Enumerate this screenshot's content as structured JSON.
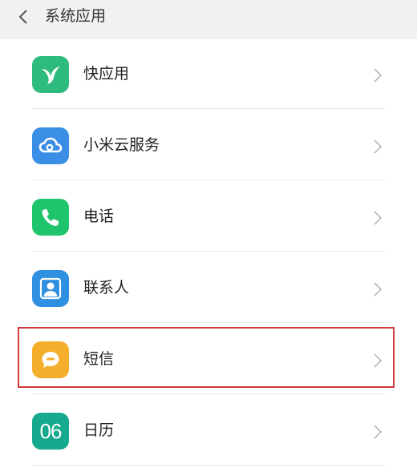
{
  "header": {
    "title": "系统应用"
  },
  "items": [
    {
      "label": "快应用",
      "icon": "quick-app-icon",
      "color": "#2dbc7e"
    },
    {
      "label": "小米云服务",
      "icon": "cloud-icon",
      "color": "#3b8ee6"
    },
    {
      "label": "电话",
      "icon": "phone-icon",
      "color": "#20c46c"
    },
    {
      "label": "联系人",
      "icon": "contacts-icon",
      "color": "#2f8fe0"
    },
    {
      "label": "短信",
      "icon": "message-icon",
      "color": "#f5ae2c"
    },
    {
      "label": "日历",
      "icon": "calendar-icon",
      "color": "#16a98d",
      "icon_text": "06"
    }
  ],
  "highlight_color": "#d13a3a"
}
